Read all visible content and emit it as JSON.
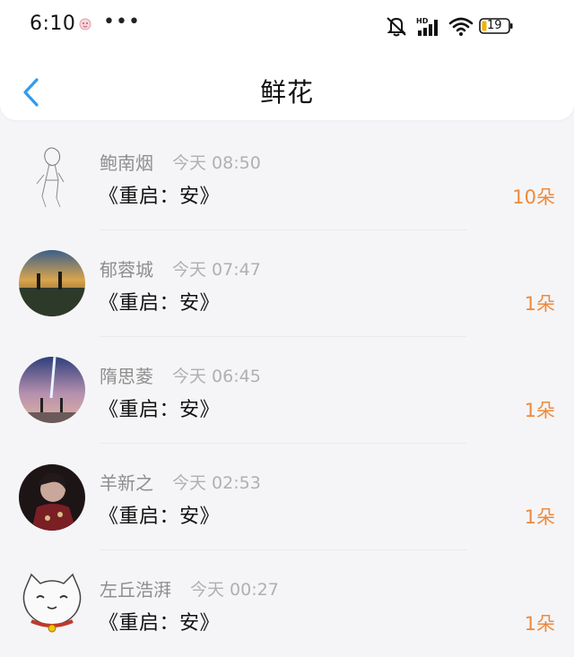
{
  "status_bar": {
    "time": "6:10",
    "dots": "•••",
    "battery_level": "19"
  },
  "header": {
    "title": "鲜花"
  },
  "items": [
    {
      "name": "鲍南烟",
      "time": "今天 08:50",
      "title": "《重启：安》",
      "count": "10朵"
    },
    {
      "name": "郁蓉城",
      "time": "今天 07:47",
      "title": "《重启：安》",
      "count": "1朵"
    },
    {
      "name": "隋思菱",
      "time": "今天 06:45",
      "title": "《重启：安》",
      "count": "1朵"
    },
    {
      "name": "羊新之",
      "time": "今天 02:53",
      "title": "《重启：安》",
      "count": "1朵"
    },
    {
      "name": "左丘浩湃",
      "time": "今天 00:27",
      "title": "《重启：安》",
      "count": "1朵"
    }
  ],
  "colors": {
    "accent": "#2f9bf0",
    "count": "#ee8a3d"
  }
}
